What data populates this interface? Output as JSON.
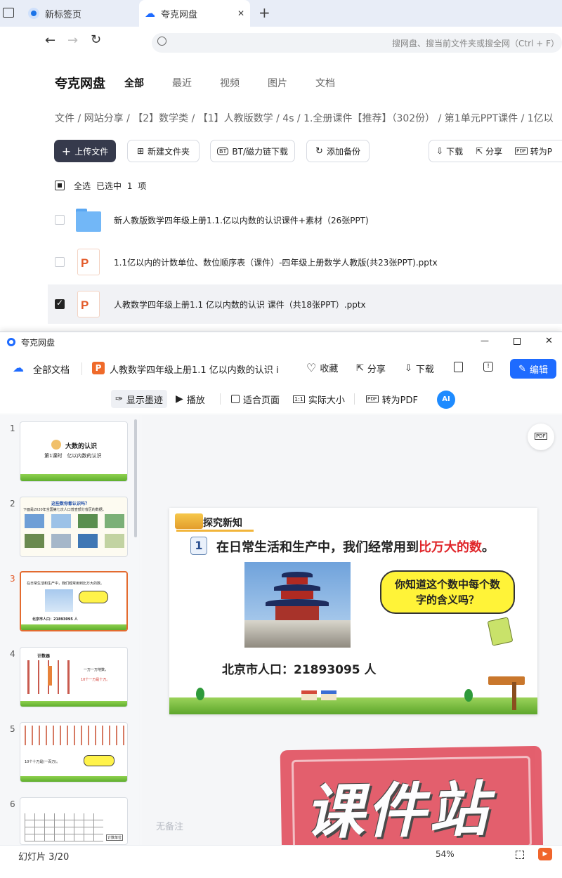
{
  "browser": {
    "tabs": [
      {
        "label": "新标签页"
      },
      {
        "label": "夸克网盘"
      }
    ],
    "new_tab": "+",
    "close": "✕",
    "address_placeholder": "搜网盘、搜当前文件夹或搜全网（Ctrl + F）"
  },
  "drive": {
    "logo": "夸克网盘",
    "nav": [
      "全部",
      "最近",
      "视频",
      "图片",
      "文档"
    ],
    "breadcrumb": "文件 / 网站分享 / 【2】数学类 / 【1】人教版数学 / 4s / 1.全册课件【推荐】（302份） / 第1单元PPT课件 / 1亿以",
    "actions": {
      "upload": "上传文件",
      "new_folder": "新建文件夹",
      "bt": "BT/磁力链下载",
      "backup": "添加备份",
      "download": "下载",
      "share": "分享",
      "to_pdf": "转为P"
    },
    "select_all": "全选",
    "selected_status": "已选中 1 项",
    "files": [
      {
        "name": "新人教版数学四年级上册1.1.亿以内数的认识课件+素材（26张PPT)",
        "type": "folder",
        "checked": false
      },
      {
        "name": "1.1亿以内的计数单位、数位顺序表（课件）-四年级上册数学人教版(共23张PPT).pptx",
        "type": "pptx",
        "checked": false
      },
      {
        "name": "人教数学四年级上册1.1 亿以内数的认识 课件（共18张PPT）.pptx",
        "type": "pptx",
        "checked": true
      }
    ]
  },
  "viewer": {
    "title": "夸克网盘",
    "win_min": "—",
    "win_close": "✕",
    "all_docs": "全部文档",
    "doc_name": "人教数学四年级上册1.1 亿以内数的认识 i",
    "favorite": "收藏",
    "share": "分享",
    "download": "下载",
    "edit": "编辑",
    "toolbar": {
      "ink": "显示墨迹",
      "play": "播放",
      "fit": "适合页面",
      "actual": "实际大小",
      "to_pdf": "转为PDF",
      "ai": "AI"
    },
    "thumb_numbers": [
      "1",
      "2",
      "3",
      "4",
      "5",
      "6"
    ],
    "thumbs": {
      "t1_title": "大数的认识",
      "t1_sub": "第1课时　亿以内数的认识",
      "t2_title": "这些数你都认识吗？",
      "t2_text": "下面是2020年全国第七次人口普查部分省区的数据。",
      "t3_text": "在日常生活和生产中，我们经常用到比万大的数。",
      "t3_pop": "北京市人口：21893095 人",
      "t4_title": "计数器",
      "t4_text1": "一万一万地数，",
      "t4_text2": "10个一万是十万。",
      "t5_text": "10个十万是(一百万)。",
      "t6_text": "计数单位"
    },
    "slide": {
      "tag": "探究新知",
      "number": "1",
      "sentence_a": "在日常生活和生产中，我们经常用到",
      "sentence_b": "比万大的数",
      "sentence_c": "。",
      "bubble": "你知道这个数中每个数字的含义吗？",
      "population": "北京市人口：21893095 人"
    },
    "notes": "无备注",
    "status": "幻灯片 3/20",
    "zoom": "54%",
    "watermark": "课件站"
  }
}
